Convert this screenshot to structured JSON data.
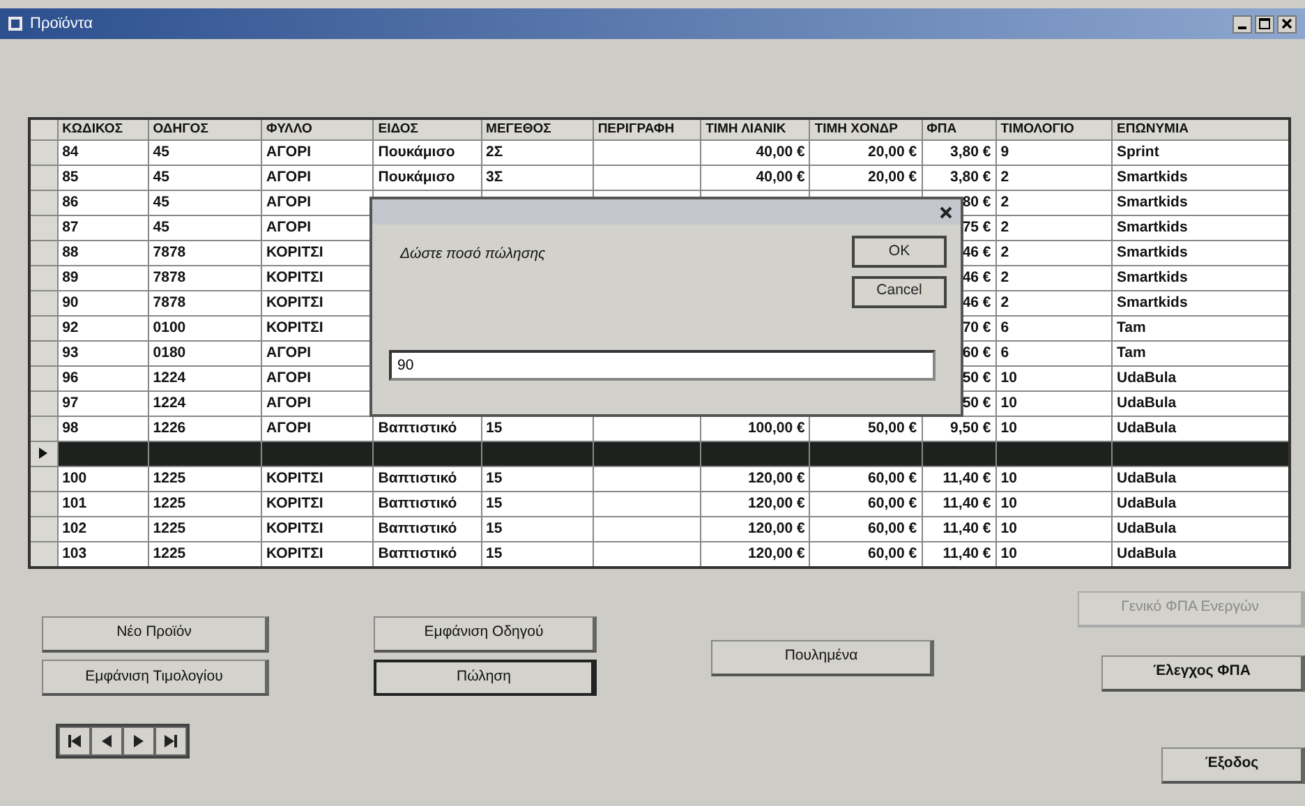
{
  "window": {
    "title": "Προϊόντα"
  },
  "table": {
    "columns": [
      "ΚΩΔΙΚΟΣ",
      "ΟΔΗΓΟΣ",
      "ΦΥΛΛΟ",
      "ΕΙΔΟΣ",
      "ΜΕΓΕΘΟΣ",
      "ΠΕΡΙΓΡΑΦΗ",
      "ΤΙΜΗ ΛΙΑΝΙΚ",
      "ΤΙΜΗ ΧΟΝΔΡ",
      "ΦΠΑ",
      "ΤΙΜΟΛΟΓΙΟ",
      "ΕΠΩΝΥΜΙΑ"
    ],
    "rows": [
      {
        "selected": false,
        "cells": [
          "84",
          "45",
          "ΑΓΟΡΙ",
          "Πουκάμισο",
          "2Σ",
          null,
          "40,00 €",
          "20,00 €",
          "3,80 €",
          "9",
          "Sprint"
        ]
      },
      {
        "selected": false,
        "cells": [
          "85",
          "45",
          "ΑΓΟΡΙ",
          "Πουκάμισο",
          "3Σ",
          null,
          "40,00 €",
          "20,00 €",
          "3,80 €",
          "2",
          "Smartkids"
        ]
      },
      {
        "selected": false,
        "cells": [
          "86",
          "45",
          "ΑΓΟΡΙ",
          null,
          null,
          null,
          null,
          null,
          "80 €",
          "2",
          "Smartkids"
        ]
      },
      {
        "selected": false,
        "cells": [
          "87",
          "45",
          "ΑΓΟΡΙ",
          null,
          null,
          null,
          null,
          null,
          "75 €",
          "2",
          "Smartkids"
        ]
      },
      {
        "selected": false,
        "cells": [
          "88",
          "7878",
          "ΚΟΡΙΤΣΙ",
          null,
          null,
          null,
          null,
          null,
          "46 €",
          "2",
          "Smartkids"
        ]
      },
      {
        "selected": false,
        "cells": [
          "89",
          "7878",
          "ΚΟΡΙΤΣΙ",
          null,
          null,
          null,
          null,
          null,
          "46 €",
          "2",
          "Smartkids"
        ]
      },
      {
        "selected": false,
        "cells": [
          "90",
          "7878",
          "ΚΟΡΙΤΣΙ",
          null,
          null,
          null,
          null,
          null,
          "46 €",
          "2",
          "Smartkids"
        ]
      },
      {
        "selected": false,
        "cells": [
          "92",
          "0100",
          "ΚΟΡΙΤΣΙ",
          null,
          null,
          null,
          null,
          null,
          "70 €",
          "6",
          "Tam"
        ]
      },
      {
        "selected": false,
        "cells": [
          "93",
          "0180",
          "ΑΓΟΡΙ",
          null,
          null,
          null,
          null,
          null,
          "60 €",
          "6",
          "Tam"
        ]
      },
      {
        "selected": false,
        "cells": [
          "96",
          "1224",
          "ΑΓΟΡΙ",
          null,
          null,
          null,
          null,
          null,
          "50 €",
          "10",
          "UdaBula"
        ]
      },
      {
        "selected": false,
        "cells": [
          "97",
          "1224",
          "ΑΓΟΡΙ",
          null,
          null,
          null,
          null,
          null,
          "50 €",
          "10",
          "UdaBula"
        ]
      },
      {
        "selected": false,
        "cells": [
          "98",
          "1226",
          "ΑΓΟΡΙ",
          "Βαπτιστικό",
          "15",
          null,
          "100,00 €",
          "50,00 €",
          "9,50 €",
          "10",
          "UdaBula"
        ]
      },
      {
        "selected": true,
        "cells": [
          null,
          null,
          null,
          null,
          null,
          null,
          null,
          null,
          null,
          null,
          null
        ]
      },
      {
        "selected": false,
        "cells": [
          "100",
          "1225",
          "ΚΟΡΙΤΣΙ",
          "Βαπτιστικό",
          "15",
          null,
          "120,00 €",
          "60,00 €",
          "11,40 €",
          "10",
          "UdaBula"
        ]
      },
      {
        "selected": false,
        "cells": [
          "101",
          "1225",
          "ΚΟΡΙΤΣΙ",
          "Βαπτιστικό",
          "15",
          null,
          "120,00 €",
          "60,00 €",
          "11,40 €",
          "10",
          "UdaBula"
        ]
      },
      {
        "selected": false,
        "cells": [
          "102",
          "1225",
          "ΚΟΡΙΤΣΙ",
          "Βαπτιστικό",
          "15",
          null,
          "120,00 €",
          "60,00 €",
          "11,40 €",
          "10",
          "UdaBula"
        ]
      },
      {
        "selected": false,
        "cells": [
          "103",
          "1225",
          "ΚΟΡΙΤΣΙ",
          "Βαπτιστικό",
          "15",
          null,
          "120,00 €",
          "60,00 €",
          "11,40 €",
          "10",
          "UdaBula"
        ]
      }
    ]
  },
  "dialog": {
    "prompt": "Δώστε ποσό πώλησης",
    "value": "90",
    "buttons": [
      "OK",
      "Cancel"
    ]
  },
  "buttons": [
    {
      "label": "Νέο Προϊόν",
      "disabled": false,
      "focused": false
    },
    {
      "label": "Εμφάνιση Τιμολογίου",
      "disabled": false,
      "focused": false
    },
    {
      "label": "Εμφάνιση Οδηγού",
      "disabled": false,
      "focused": false
    },
    {
      "label": "Πώληση",
      "disabled": false,
      "focused": true
    },
    {
      "label": "Πουλημένα",
      "disabled": false,
      "focused": false
    },
    {
      "label": "Γενικό ΦΠΑ Ενεργών",
      "disabled": true,
      "focused": false
    },
    {
      "label": "Έλεγχος ΦΠΑ",
      "disabled": false,
      "focused": false
    },
    {
      "label": "Έξοδος",
      "disabled": false,
      "focused": false
    }
  ]
}
